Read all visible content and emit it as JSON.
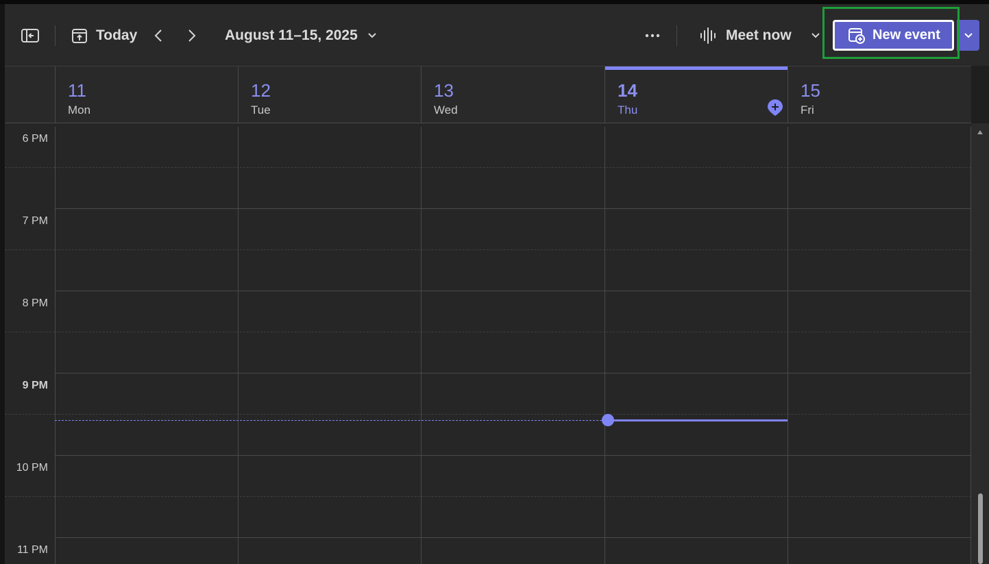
{
  "toolbar": {
    "today_label": "Today",
    "date_range": "August 11–15, 2025",
    "meet_now_label": "Meet now",
    "new_event_label": "New event"
  },
  "days": [
    {
      "num": "11",
      "name": "Mon"
    },
    {
      "num": "12",
      "name": "Tue"
    },
    {
      "num": "13",
      "name": "Wed"
    },
    {
      "num": "14",
      "name": "Thu"
    },
    {
      "num": "15",
      "name": "Fri"
    }
  ],
  "times": [
    "6 PM",
    "7 PM",
    "8 PM",
    "9 PM",
    "10 PM",
    "11 PM"
  ],
  "colors": {
    "accent": "#7f85f5",
    "button": "#5b5fc7",
    "highlight_box": "#1e9e3a"
  }
}
